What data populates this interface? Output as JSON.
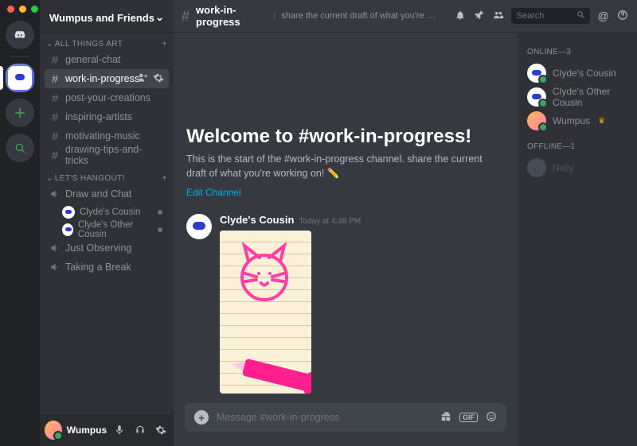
{
  "server": {
    "name": "Wumpus and Friends"
  },
  "categories": {
    "art": {
      "label": "ALL THINGS ART",
      "channels": [
        {
          "name": "general-chat"
        },
        {
          "name": "work-in-progress"
        },
        {
          "name": "post-your-creations"
        },
        {
          "name": "inspiring-artists"
        },
        {
          "name": "motivating-music"
        },
        {
          "name": "drawing-tips-and-tricks"
        }
      ]
    },
    "hangout": {
      "label": "LET'S HANGOUT!",
      "voice": [
        {
          "name": "Draw and Chat",
          "users": [
            {
              "name": "Clyde's Cousin"
            },
            {
              "name": "Clyde's Other Cousin"
            }
          ]
        },
        {
          "name": "Just Observing"
        },
        {
          "name": "Taking a Break"
        }
      ]
    }
  },
  "current_channel": {
    "name": "work-in-progress",
    "topic": "share the current draft of what you're working on…",
    "welcome_title": "Welcome to #work-in-progress!",
    "welcome_body": "This is the start of the #work-in-progress channel. share the current draft of what you're working on! ✏️",
    "edit_label": "Edit Channel",
    "composer_placeholder": "Message #work-in-progress"
  },
  "message": {
    "author": "Clyde's Cousin",
    "timestamp": "Today at 4:48 PM"
  },
  "search": {
    "placeholder": "Search"
  },
  "user_panel": {
    "name": "Wumpus"
  },
  "members": {
    "online_label": "ONLINE—3",
    "offline_label": "OFFLINE—1",
    "online": [
      {
        "name": "Clyde's Cousin"
      },
      {
        "name": "Clyde's Other Cousin"
      },
      {
        "name": "Wumpus",
        "owner": true
      }
    ],
    "offline": [
      {
        "name": "Nelly"
      }
    ]
  },
  "gif_label": "GIF"
}
